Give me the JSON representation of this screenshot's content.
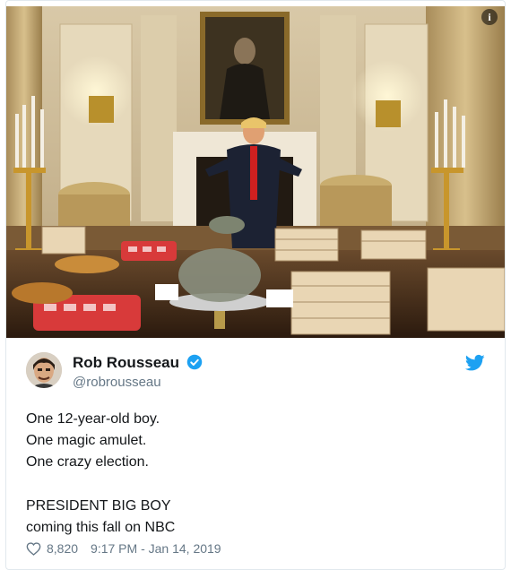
{
  "tweet": {
    "display_name": "Rob Rousseau",
    "handle": "@robrousseau",
    "lines": [
      "One 12-year-old boy.",
      "One magic amulet.",
      "One crazy election.",
      "PRESIDENT BIG BOY",
      "coming this fall on NBC"
    ],
    "likes": "8,820",
    "timestamp": "9:17 PM - Jan 14, 2019"
  },
  "media": {
    "info_glyph": "i",
    "description_icon": "info-icon"
  },
  "colors": {
    "twitter_blue": "#1da1f2",
    "meta_gray": "#657786",
    "text": "#14171a",
    "border": "#e1e8ed"
  }
}
